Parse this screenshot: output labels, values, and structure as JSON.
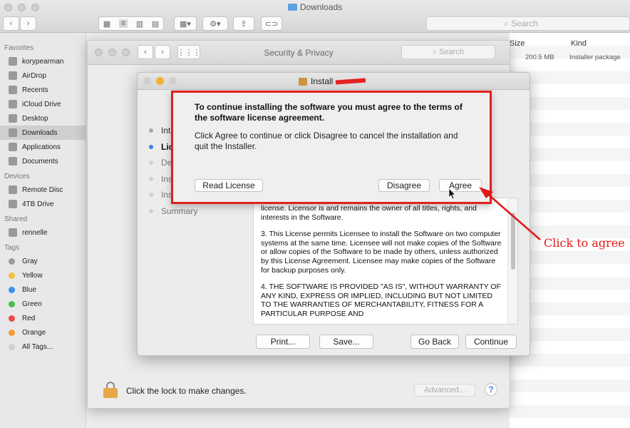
{
  "finder": {
    "title": "Downloads",
    "search_placeholder": "Search",
    "sidebar": {
      "favorites_header": "Favorites",
      "favorites": [
        {
          "label": "korypearman",
          "icon": "home-icon"
        },
        {
          "label": "AirDrop",
          "icon": "airdrop-icon"
        },
        {
          "label": "Recents",
          "icon": "recents-icon"
        },
        {
          "label": "iCloud Drive",
          "icon": "cloud-icon"
        },
        {
          "label": "Desktop",
          "icon": "desktop-icon"
        },
        {
          "label": "Downloads",
          "icon": "downloads-icon"
        },
        {
          "label": "Applications",
          "icon": "applications-icon"
        },
        {
          "label": "Documents",
          "icon": "documents-icon"
        }
      ],
      "devices_header": "Devices",
      "devices": [
        {
          "label": "Remote Disc",
          "icon": "disc-icon"
        },
        {
          "label": "4TB Drive",
          "icon": "drive-icon"
        }
      ],
      "shared_header": "Shared",
      "shared": [
        {
          "label": "rennelle",
          "icon": "computer-icon"
        }
      ],
      "tags_header": "Tags",
      "tags": [
        {
          "label": "Gray",
          "color": "#9c9c9c"
        },
        {
          "label": "Yellow",
          "color": "#f1c33c"
        },
        {
          "label": "Blue",
          "color": "#3d8ff0"
        },
        {
          "label": "Green",
          "color": "#46bd4a"
        },
        {
          "label": "Red",
          "color": "#ee4a44"
        },
        {
          "label": "Orange",
          "color": "#f29b33"
        },
        {
          "label": "All Tags...",
          "color": "#d0d0d0"
        }
      ]
    },
    "columns": {
      "size": "Size",
      "kind": "Kind"
    },
    "row": {
      "size": "200.5 MB",
      "kind": "Installer package"
    }
  },
  "security": {
    "title": "Security & Privacy",
    "search_placeholder": "Search",
    "lock_text": "Click the lock to make changes.",
    "advanced_label": "Advanced...",
    "help_label": "?"
  },
  "installer": {
    "title": "Install",
    "steps": [
      {
        "label": "Intr",
        "state": "done"
      },
      {
        "label": "Lic",
        "state": "current"
      },
      {
        "label": "De",
        "state": "pending"
      },
      {
        "label": "Ins",
        "state": "pending"
      },
      {
        "label": "Ins",
        "state": "pending"
      },
      {
        "label": "Summary",
        "state": "pending"
      }
    ],
    "license_paragraphs": [
      "license. Licensor is and remains the owner of all titles, rights, and interests in the Software.",
      "3. This License permits Licensee to install the Software on two computer systems at the same time. Licensee will not make copies of the Software or allow copies of the Software to be made by others, unless authorized by this License Agreement. Licensee may make copies of the Software for backup purposes only.",
      "4. THE SOFTWARE IS PROVIDED \"AS IS\", WITHOUT WARRANTY OF ANY KIND, EXPRESS OR IMPLIED, INCLUDING BUT NOT LIMITED TO THE WARRANTIES OF MERCHANTABILITY, FITNESS FOR A PARTICULAR PURPOSE AND"
    ],
    "buttons": {
      "print": "Print...",
      "save": "Save...",
      "go_back": "Go Back",
      "continue": "Continue"
    }
  },
  "dialog": {
    "title": "To continue installing the software you must agree to the terms of the software license agreement.",
    "body": "Click Agree to continue or click Disagree to cancel the installation and quit the Installer.",
    "read_license": "Read License",
    "disagree": "Disagree",
    "agree": "Agree"
  },
  "annotation": {
    "label": "Click to agree",
    "color": "#e01818"
  }
}
